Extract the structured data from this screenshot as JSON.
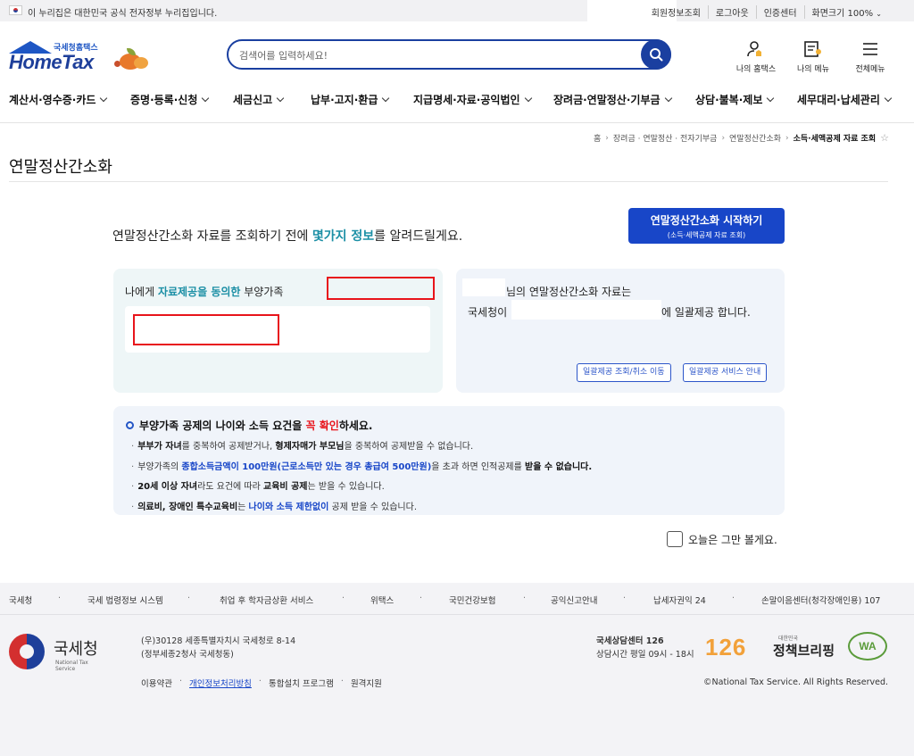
{
  "gov_bar": {
    "notice": "이 누리집은 대한민국 공식 전자정부 누리집입니다.",
    "util_links": [
      "회원정보조회",
      "로그아웃",
      "인증센터",
      "화면크기 100%"
    ]
  },
  "header": {
    "logo_sub": "국세청홈택스",
    "logo_main": "HomeTax",
    "search_placeholder": "검색어를 입력하세요!",
    "icons": [
      {
        "label": "나의 홈택스",
        "icon": "my-hometax-icon"
      },
      {
        "label": "나의 메뉴",
        "icon": "my-menu-icon"
      },
      {
        "label": "전체메뉴",
        "icon": "hamburger-icon"
      }
    ]
  },
  "nav": [
    "계산서·영수증·카드",
    "증명·등록·신청",
    "세금신고",
    "납부·고지·환급",
    "지급명세·자료·공익법인",
    "장려금·연말정산·기부금",
    "상담·불복·제보",
    "세무대리·납세관리"
  ],
  "breadcrumb": [
    "홈",
    "장려금 · 연말정산 · 전자기부금",
    "연말정산간소화",
    "소득·세액공제 자료 조회"
  ],
  "page_title": "연말정산간소화",
  "intro": {
    "before": "연말정산간소화 자료를 조회하기 전에 ",
    "highlight": "몇가지 정보",
    "after": "를 알려드릴게요."
  },
  "start_button": {
    "line1": "연말정산간소화 시작하기",
    "line2": "(소득·세액공제 자료 조회)"
  },
  "dependents_card": {
    "prefix": "나에게 ",
    "highlight": "자료제공을 동의한",
    "suffix": " 부양가족"
  },
  "provision_card": {
    "line1": "님의 연말정산간소화 자료는",
    "line2_prefix": "국세청이",
    "line2_suffix": "에 일괄제공 합니다.",
    "btn_manage": "일괄제공 조회/취소 이동",
    "btn_guide": "일괄제공 서비스 안내"
  },
  "notice": {
    "head_a": "부양가족 공제의 나이와 소득 요건을 ",
    "head_red": "꼭 확인",
    "head_b": "하세요.",
    "items": [
      [
        {
          "t": "부부가 자녀",
          "s": "b"
        },
        {
          "t": "를 중복하여 공제받거나, "
        },
        {
          "t": "형제자매가 부모님",
          "s": "b"
        },
        {
          "t": "을 중복하여 공제받을 수 없습니다."
        }
      ],
      [
        {
          "t": "부양가족의 "
        },
        {
          "t": "종합소득금액이 100만원(근로소득만 있는 경우 총급여 500만원)",
          "s": "blue"
        },
        {
          "t": "을 초과 하면 인적공제를 "
        },
        {
          "t": "받을 수 없습니다.",
          "s": "b"
        }
      ],
      [
        {
          "t": "20세 이상 자녀",
          "s": "b"
        },
        {
          "t": "라도 요건에 따라 "
        },
        {
          "t": "교육비 공제",
          "s": "b"
        },
        {
          "t": "는 받을 수 있습니다."
        }
      ],
      [
        {
          "t": "의료비, 장애인 특수교육비",
          "s": "b"
        },
        {
          "t": "는 "
        },
        {
          "t": "나이와 소득 제한없이",
          "s": "blue"
        },
        {
          "t": " 공제 받을 수 있습니다."
        }
      ]
    ]
  },
  "dismiss_label": "오늘은 그만 볼게요.",
  "footer": {
    "links": [
      "국세청",
      "국세 법령정보 시스템",
      "취업 후 학자금상환 서비스",
      "위택스",
      "국민건강보험",
      "공익신고안내",
      "납세자권익 24",
      "손말이음센터(청각장애인용) 107"
    ],
    "org_name": "국세청",
    "org_en": "National Tax Service",
    "address_1": "(우)30128 세종특별자치시 국세청로 8-14",
    "address_2": "(정부세종2청사 국세청동)",
    "bottom_links": [
      "이용약관",
      "개인정보처리방침",
      "통합설치 프로그램",
      "원격지원"
    ],
    "center_title": "국세상담센터 126",
    "center_hours": "상담시간 평일 09시 - 18시",
    "logo_126": "126",
    "briefing_small": "대한민국",
    "briefing_main": "정책브리핑",
    "wa_mark": "WA",
    "copyright": "©National Tax Service. All Rights Reserved."
  }
}
